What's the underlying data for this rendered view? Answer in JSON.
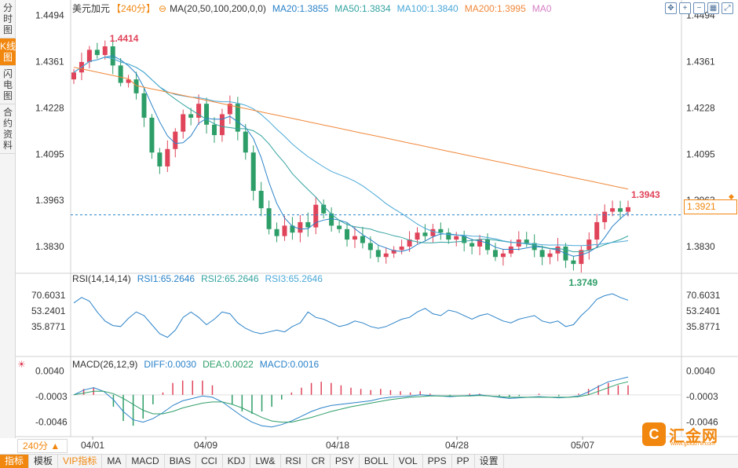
{
  "left_tabs": [
    "分时图",
    "K线图",
    "闪电图",
    "合约资料"
  ],
  "left_tab_active": 1,
  "legend": {
    "symbol": "美元加元",
    "period": "【240分】",
    "ma_label": "MA(20,50,100,200,0,0)",
    "ma20": "MA20:1.3855",
    "ma50": "MA50:1.3834",
    "ma100": "MA100:1.3840",
    "ma200": "MA200:1.3995",
    "ma0": "MA0",
    "rsi_label": "RSI(14,14,14)",
    "rsi1": "RSI1:65.2646",
    "rsi2": "RSI2:65.2646",
    "rsi3": "RSI3:65.2646",
    "macd_label": "MACD(26,12,9)",
    "diff": "DIFF:0.0030",
    "dea": "DEA:0.0022",
    "macd": "MACD:0.0016"
  },
  "colors": {
    "up": "#e0445a",
    "down": "#2e9e68",
    "ma20": "#2a82c8",
    "ma50": "#33a3a0",
    "ma100": "#4aa8d8",
    "ma200": "#f0883a",
    "ma0": "#d57fc4",
    "accent": "#f1870f",
    "rsi": "#2a82c8",
    "diff": "#2a82c8",
    "dea": "#2e9e68",
    "max_label": "#e0445a",
    "min_label": "#2e9e68"
  },
  "price_axis": [
    "1.4494",
    "1.4361",
    "1.4228",
    "1.4095",
    "1.3963",
    "1.3830"
  ],
  "rsi_axis": [
    "70.6031",
    "53.2401",
    "35.8771"
  ],
  "macd_axis": [
    "0.0040",
    "-0.0003",
    "-0.0046"
  ],
  "date_labels": [
    "04/01",
    "04/09",
    "04/18",
    "04/28",
    "05/07"
  ],
  "current_price": "1.3921",
  "max_label": "1.4414",
  "min_label": "1.3749",
  "last_label": "1.3943",
  "toolbar_icons": [
    "move-icon",
    "zoom-in-icon",
    "zoom-out-icon",
    "grid-icon",
    "fullscreen-icon"
  ],
  "period_select": "240分 ▲",
  "bottom_tabs": [
    "指标",
    "模板",
    "VIP指标",
    "MA",
    "MACD",
    "BIAS",
    "CCI",
    "KDJ",
    "LW&",
    "RSI",
    "CR",
    "PSY",
    "BOLL",
    "VOL",
    "PPS",
    "PP",
    "设置"
  ],
  "watermark": {
    "logo": "C",
    "text": "汇金网",
    "url": "www.gold678.com"
  },
  "chart_data": {
    "type": "candlestick",
    "x_dates": [
      "04/01",
      "04/09",
      "04/18",
      "04/28",
      "05/07"
    ],
    "y_axis": {
      "min": 1.376,
      "max": 1.452,
      "ticks": [
        1.4494,
        1.4361,
        1.4228,
        1.4095,
        1.3963,
        1.383
      ]
    },
    "ma_last": {
      "MA20": 1.3855,
      "MA50": 1.3834,
      "MA100": 1.384,
      "MA200": 1.3995
    },
    "close_path": [
      1.433,
      1.436,
      1.4395,
      1.438,
      1.4405,
      1.435,
      1.43,
      1.431,
      1.427,
      1.42,
      1.41,
      1.406,
      1.411,
      1.416,
      1.421,
      1.42,
      1.424,
      1.418,
      1.415,
      1.421,
      1.424,
      1.416,
      1.41,
      1.399,
      1.394,
      1.388,
      1.386,
      1.389,
      1.387,
      1.39,
      1.3885,
      1.395,
      1.3925,
      1.389,
      1.388,
      1.385,
      1.386,
      1.384,
      1.382,
      1.38,
      1.381,
      1.382,
      1.383,
      1.385,
      1.387,
      1.386,
      1.388,
      1.387,
      1.385,
      1.386,
      1.384,
      1.383,
      1.385,
      1.382,
      1.38,
      1.381,
      1.383,
      1.385,
      1.384,
      1.382,
      1.38,
      1.381,
      1.383,
      1.379,
      1.378,
      1.382,
      1.385,
      1.39,
      1.393,
      1.394,
      1.393,
      1.3943
    ],
    "highlight": {
      "max": 1.4414,
      "min": 1.3749,
      "last": 1.3943,
      "current": 1.3921
    },
    "rsi": {
      "axis_ticks": [
        70.6031,
        53.2401,
        35.8771
      ],
      "last": 65.2646,
      "values": [
        62,
        68,
        64,
        52,
        42,
        37,
        36,
        45,
        52,
        48,
        38,
        28,
        24,
        32,
        46,
        52,
        46,
        38,
        44,
        52,
        50,
        40,
        34,
        30,
        28,
        30,
        32,
        30,
        36,
        40,
        52,
        46,
        44,
        40,
        36,
        38,
        42,
        40,
        36,
        34,
        36,
        40,
        44,
        46,
        52,
        56,
        50,
        48,
        54,
        52,
        48,
        44,
        48,
        50,
        46,
        42,
        40,
        44,
        46,
        48,
        42,
        40,
        42,
        36,
        38,
        48,
        56,
        66,
        70,
        72,
        68,
        65
      ]
    },
    "macd": {
      "axis_ticks": [
        0.004,
        -0.0003,
        -0.0046
      ],
      "last": {
        "DIFF": 0.003,
        "DEA": 0.0022,
        "MACD": 0.0016
      },
      "diff": [
        0.0,
        0.0008,
        0.0012,
        0.0006,
        -0.0008,
        -0.0028,
        -0.0042,
        -0.0046,
        -0.004,
        -0.003,
        -0.0018,
        -0.001,
        -0.0006,
        -0.0002,
        -0.0004,
        -0.0012,
        -0.0024,
        -0.0036,
        -0.0046,
        -0.0052,
        -0.0054,
        -0.005,
        -0.0044,
        -0.0036,
        -0.0028,
        -0.0022,
        -0.0018,
        -0.0016,
        -0.0014,
        -0.0012,
        -0.001,
        -0.0006,
        -0.0004,
        -0.0003,
        -0.0002,
        0.0,
        -0.0001,
        -0.0002,
        -0.0003,
        -0.0002,
        -0.0001,
        0.0,
        -0.0002,
        -0.0004,
        -0.0006,
        -0.0005,
        -0.0004,
        -0.0003,
        -0.0004,
        -0.0005,
        -0.0004,
        -0.0002,
        0.0005,
        0.0014,
        0.0022,
        0.0026,
        0.003
      ],
      "dea": [
        0.0,
        0.0003,
        0.0006,
        0.0006,
        0.0002,
        -0.0006,
        -0.0016,
        -0.0026,
        -0.0032,
        -0.0032,
        -0.0028,
        -0.0022,
        -0.0018,
        -0.0014,
        -0.0012,
        -0.0012,
        -0.0016,
        -0.0022,
        -0.003,
        -0.0038,
        -0.0044,
        -0.0046,
        -0.0046,
        -0.0042,
        -0.0038,
        -0.0033,
        -0.0028,
        -0.0024,
        -0.002,
        -0.0017,
        -0.0014,
        -0.0011,
        -0.0008,
        -0.0006,
        -0.0004,
        -0.0003,
        -0.0002,
        -0.0002,
        -0.0002,
        -0.0002,
        -0.0002,
        -0.0001,
        -0.0002,
        -0.0003,
        -0.0004,
        -0.0004,
        -0.0004,
        -0.0004,
        -0.0004,
        -0.0004,
        -0.0004,
        -0.0003,
        0.0,
        0.0006,
        0.0012,
        0.0018,
        0.0022
      ]
    }
  }
}
